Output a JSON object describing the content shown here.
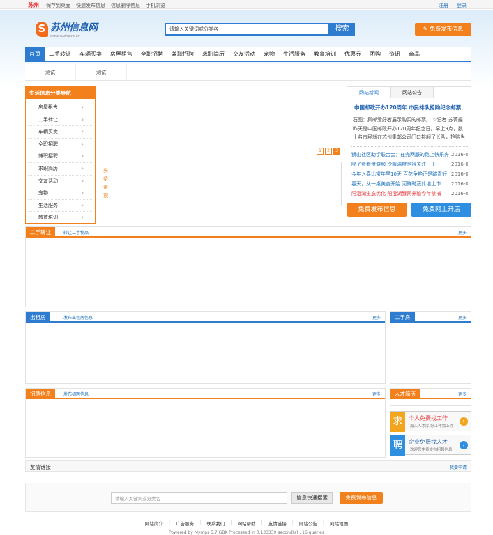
{
  "topbar": {
    "city": "苏州",
    "links": [
      "保存到桌面",
      "快速发布信息",
      "信息删除信息",
      "手机浏览"
    ],
    "login": "注册",
    "register": "登录"
  },
  "logo": {
    "mark": "S",
    "name": "苏州信息网",
    "url": "www.suzhouw.cn"
  },
  "search": {
    "placeholder": "请输入关键词或分类名",
    "button": "搜索"
  },
  "publish_button": "免费发布信息",
  "nav": [
    "首页",
    "二手转让",
    "车辆买卖",
    "房屋租售",
    "全职招聘",
    "兼职招聘",
    "求职简历",
    "交友活动",
    "宠物",
    "生活服务",
    "教育培训",
    "优惠券",
    "团购",
    "资讯",
    "商品"
  ],
  "subnav": [
    "测试",
    "测试"
  ],
  "category": {
    "title": "生活信息分类导航",
    "items": [
      "房屋租售",
      "二手转让",
      "车辆买卖",
      "全职招聘",
      "兼职招聘",
      "求职简历",
      "交友活动",
      "宠物",
      "生活服务",
      "教育培训"
    ]
  },
  "pager": [
    "1",
    "2",
    "3"
  ],
  "headline_label": "头条置顶",
  "news": {
    "tabs": [
      "网站新闻",
      "网站公告"
    ],
    "headline": "中国邮政开办120周年 市民排队抢购纪念邮票",
    "summary": "石图：集邮爱好者展示购买的邮票。 ☆记者 苏菁摄 昨天是中国邮政开办120周年纪念日。早上9点，数十名市民就在苏州集邮公司门口排起了长队，抢购当天发行",
    "items": [
      {
        "t": "狮山社区助学联合会：在完两服的路上快乐奔走",
        "d": "2016-0",
        "red": false
      },
      {
        "t": "除了看看漫游和 冷暖温度也得关注一下",
        "d": "2016-0",
        "red": false
      },
      {
        "t": "今年入春比常年早10天 百花争艳正是踏青好",
        "d": "2016-0",
        "red": false
      },
      {
        "t": "春天，从一桌美食开始 河鲜时蔬扎堆上市",
        "d": "2016-0",
        "red": false
      },
      {
        "t": "阳澄湖生态优化 阳澄湖蟹网养殖今年禁捕",
        "d": "2016-0",
        "red": true
      }
    ]
  },
  "quick": {
    "publish": "免费发布信息",
    "shop": "免费网上开店"
  },
  "sections": {
    "secondhand": {
      "title": "二手转让",
      "sub": "转让二手物品",
      "more": "更多"
    },
    "rent": {
      "title": "出租房",
      "sub": "发布出租房信息",
      "more": "更多"
    },
    "used_house": {
      "title": "二手房",
      "more": "更多"
    },
    "jobs": {
      "title": "招聘信息",
      "sub": "发布招聘信息",
      "more": "更多"
    },
    "talent": {
      "title": "人才简历",
      "more": "更多"
    }
  },
  "promo": [
    {
      "icon": "求",
      "title": "个人免费找工作",
      "sub": "加入人才库 好工作找上你"
    },
    {
      "icon": "聘",
      "title": "企业免费找人才",
      "sub": "欢迎您免费发布招聘信息"
    }
  ],
  "links": {
    "title": "友情链接",
    "apply": "我要申请"
  },
  "bottom_search": {
    "placeholder": "请输入关键词或分类名",
    "search": "信息快速搜索",
    "publish": "免费发布信息"
  },
  "footer": [
    "网站简介",
    "广告服务",
    "联系我们",
    "网站帮助",
    "友情链接",
    "网站公告",
    "网站地图"
  ],
  "powered": "Powered by Mymps 5.7 GBK Processed in 0.133339 second(s) , 16 queries"
}
